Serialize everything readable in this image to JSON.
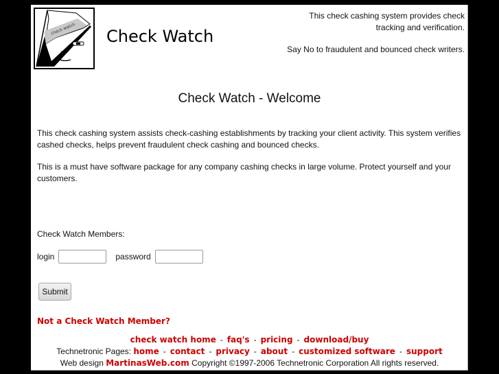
{
  "header": {
    "logo_text": "check watch",
    "site_title": "Check Watch",
    "tagline_1": "This check cashing system provides check tracking and verification.",
    "tagline_2": "Say No to fraudulent and bounced check writers."
  },
  "main": {
    "title": "Check Watch - Welcome",
    "paragraphs": [
      "This check cashing system assists check-cashing establishments by tracking your client activity. This system verifies cashed checks, helps prevent fraudulent check cashing and bounced checks.",
      "This is a must have software package for any company cashing checks in large volume. Protect yourself and your customers."
    ]
  },
  "login_form": {
    "section_label": "Check Watch Members:",
    "login_label": "login",
    "login_value": "",
    "password_label": "password",
    "password_value": "",
    "submit_label": "Submit"
  },
  "not_member_link": "Not a Check Watch Member?",
  "footer": {
    "separator": "-",
    "product_links": [
      "check watch home",
      "faq's",
      "pricing",
      "download/buy"
    ],
    "technetronic_label": "Technetronic Pages:",
    "technetronic_links": [
      "home",
      "contact",
      "privacy",
      "about",
      "customized software",
      "support"
    ],
    "web_design_label": "Web design",
    "web_design_link": "MartinasWeb.com",
    "copyright": "Copyright ©1997-2006 Technetronic Corporation All rights reserved."
  },
  "colors": {
    "link": "#cc0000",
    "background": "#000000",
    "page": "#ffffff"
  }
}
